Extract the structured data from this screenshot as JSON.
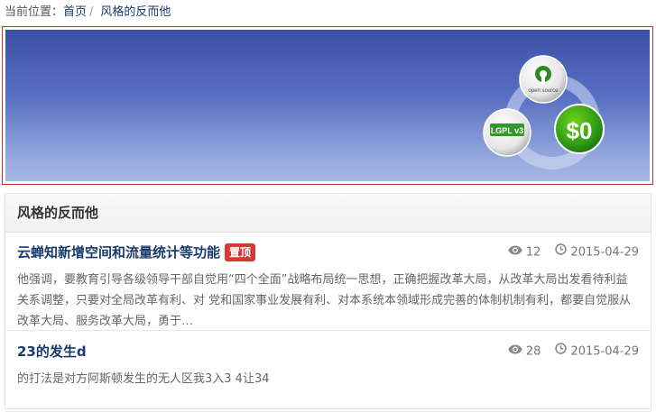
{
  "breadcrumb": {
    "prefix": "当前位置：",
    "home": "首页",
    "separator": "/",
    "current": "风格的反而他"
  },
  "banner": {
    "badge_top": "open source",
    "badge_left": "LGPL v3",
    "badge_right": "$0"
  },
  "panel": {
    "title": "风格的反而他"
  },
  "articles": [
    {
      "title": "云蝉知新增空间和流量统计等功能",
      "badge": "置顶",
      "views": "12",
      "date": "2015-04-29",
      "summary": "他强调，要教育引导各级领导干部自觉用“四个全面”战略布局统一思想，正确把握改革大局，从改革大局出发看待利益关系调整，只要对全局改革有利、对 党和国家事业发展有利、对本系统本领域形成完善的体制机制有利，都要自觉服从改革大局、服务改革大局，勇于…"
    },
    {
      "title": "23的发生d",
      "views": "28",
      "date": "2015-04-29",
      "summary": "的打法是对方阿斯顿发生的无人区我3入3 4让34"
    }
  ],
  "colors": {
    "link": "#1a3a6c",
    "badge_bg": "#d43a33",
    "banner_border": "#c9302c"
  },
  "icons": {
    "views": "eye-icon",
    "date": "clock-icon"
  }
}
